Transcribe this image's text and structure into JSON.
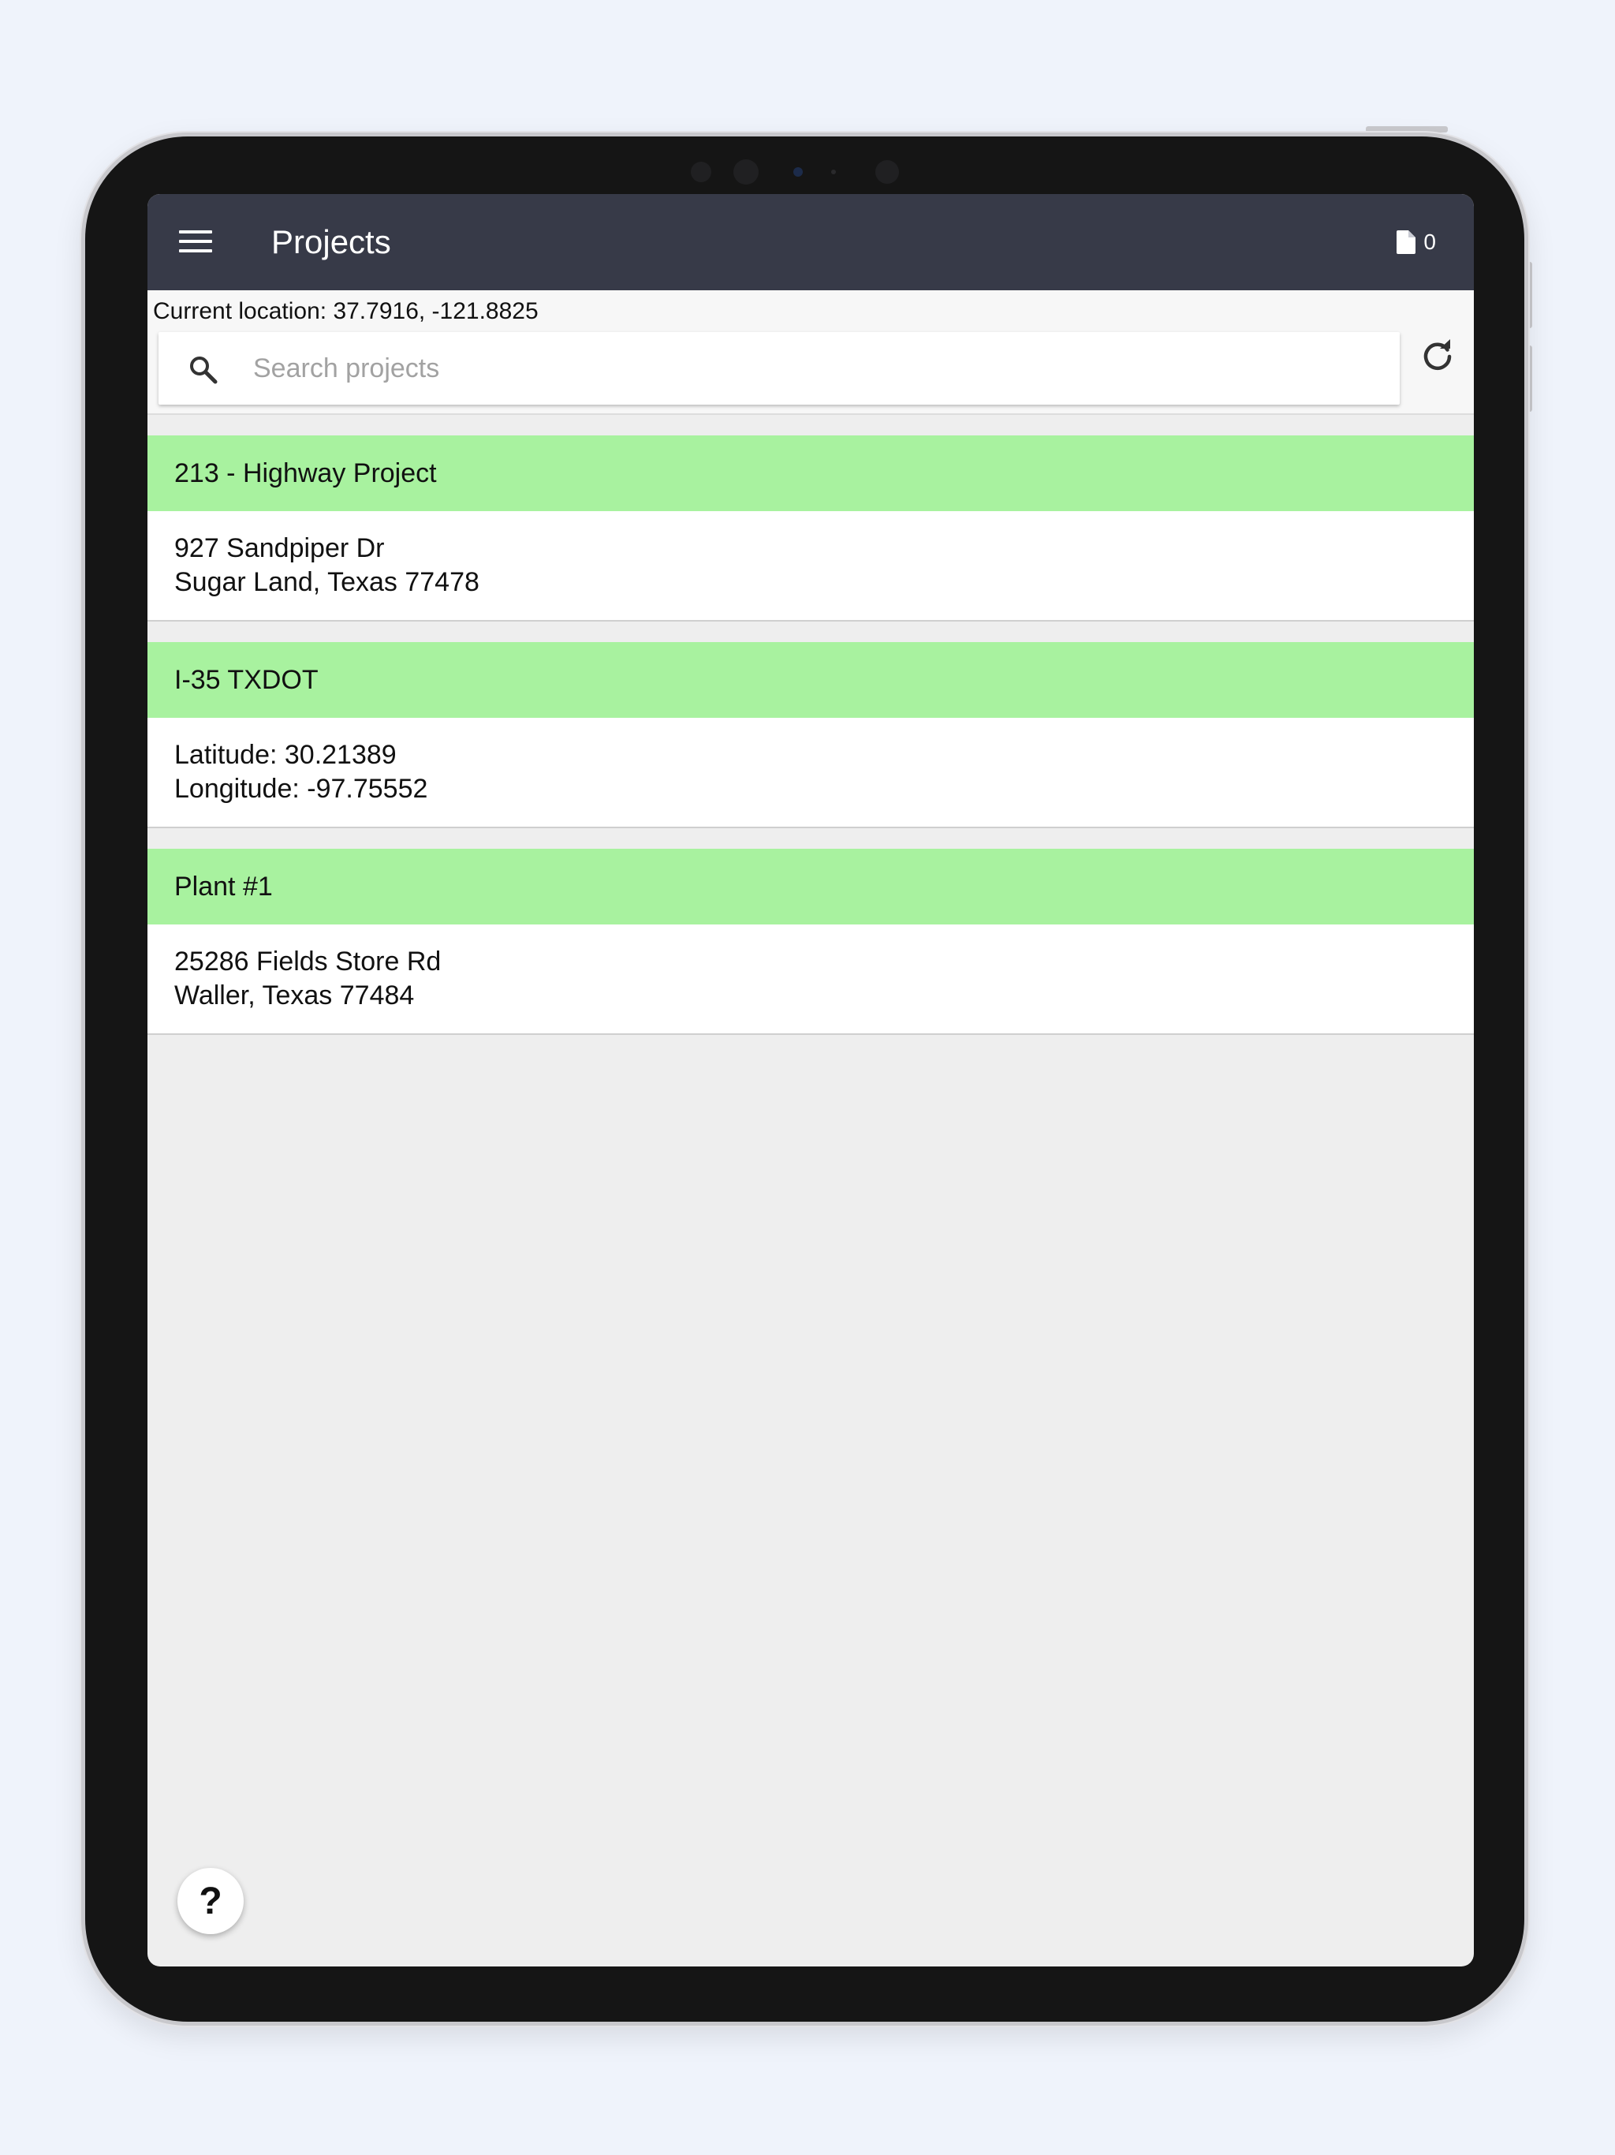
{
  "app": {
    "title": "Projects",
    "document_count": "0",
    "icons": {
      "menu": "hamburger-menu-icon",
      "document": "document-icon",
      "search": "search-icon",
      "refresh": "refresh-icon"
    }
  },
  "location": {
    "label": "Current location: 37.7916, -121.8825"
  },
  "search": {
    "placeholder": "Search projects",
    "value": ""
  },
  "projects": [
    {
      "name": "213 - Highway Project",
      "line1": "927 Sandpiper Dr",
      "line2": "Sugar Land, Texas 77478"
    },
    {
      "name": "I-35 TXDOT",
      "line1": "Latitude: 30.21389",
      "line2": "Longitude: -97.75552"
    },
    {
      "name": "Plant #1",
      "line1": "25286 Fields Store Rd",
      "line2": "Waller, Texas 77484"
    }
  ],
  "help": {
    "label": "?"
  },
  "colors": {
    "app_bar": "#373a48",
    "project_header": "#a8f29f",
    "background": "#eeeeee"
  }
}
